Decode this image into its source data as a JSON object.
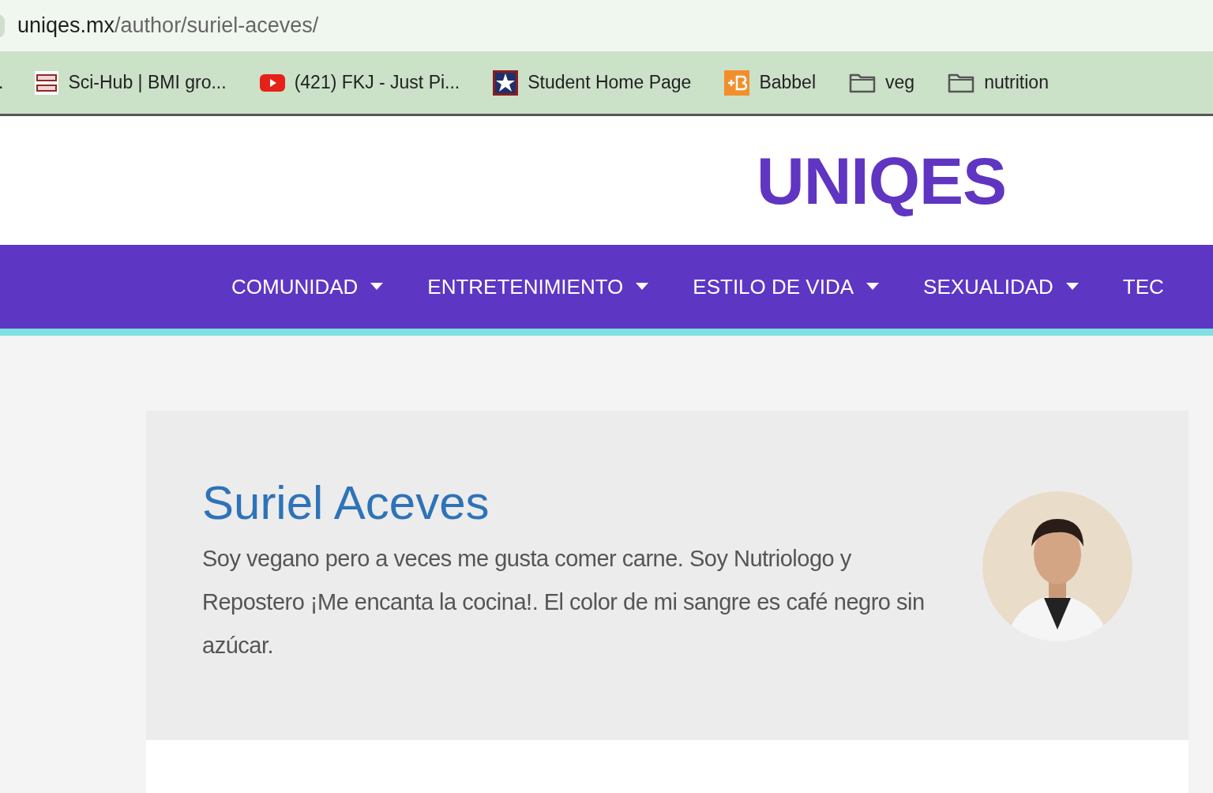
{
  "address_bar": {
    "domain": "uniqes.mx",
    "path": "/author/suriel-aceves/"
  },
  "bookmarks": [
    {
      "kind": "cut",
      "label": "."
    },
    {
      "kind": "scihub",
      "label": "Sci-Hub | BMI gro..."
    },
    {
      "kind": "youtube",
      "label": "(421) FKJ - Just Pi..."
    },
    {
      "kind": "star",
      "label": "Student Home Page"
    },
    {
      "kind": "babbel",
      "label": "Babbel"
    },
    {
      "kind": "folder",
      "label": "veg"
    },
    {
      "kind": "folder",
      "label": "nutrition"
    }
  ],
  "site": {
    "logo": "UNIQES"
  },
  "nav": [
    {
      "label": "COMUNIDAD",
      "dropdown": true
    },
    {
      "label": "ENTRETENIMIENTO",
      "dropdown": true
    },
    {
      "label": "ESTILO DE VIDA",
      "dropdown": true
    },
    {
      "label": "SEXUALIDAD",
      "dropdown": true
    },
    {
      "label": "TEC",
      "dropdown": false
    }
  ],
  "author": {
    "name": "Suriel Aceves",
    "bio": "Soy vegano pero a veces me gusta comer carne. Soy Nutriologo y Repostero ¡Me encanta la cocina!. El color de mi sangre es café negro sin azúcar."
  }
}
